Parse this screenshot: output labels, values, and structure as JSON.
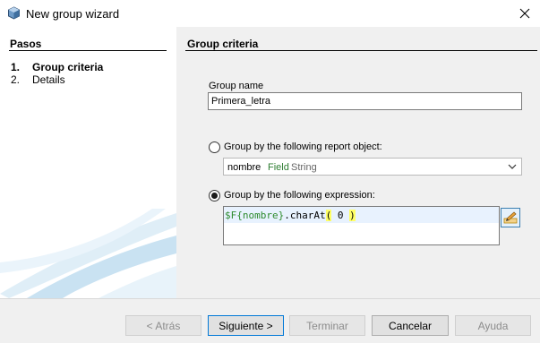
{
  "window": {
    "title": "New group wizard"
  },
  "steps": {
    "header": "Pasos",
    "items": [
      {
        "num": "1.",
        "label": "Group criteria"
      },
      {
        "num": "2.",
        "label": "Details"
      }
    ]
  },
  "panel": {
    "title": "Group criteria",
    "group_name_label": "Group name",
    "group_name_value": "Primera_letra",
    "option_report_object": "Group by the following report object:",
    "report_object": {
      "name": "nombre",
      "type": "Field",
      "class": "String"
    },
    "option_expression": "Group by the following expression:",
    "expression": {
      "part1": "$F{nombre}",
      "part2": ".charAt",
      "part3": "(",
      "part4": " 0 ",
      "part5": ")"
    }
  },
  "footer": {
    "back": "< Atrás",
    "next": "Siguiente >",
    "finish": "Terminar",
    "cancel": "Cancelar",
    "help": "Ayuda"
  },
  "colors": {
    "panel_bg": "#f0f0f0",
    "field_green": "#2e7d32",
    "highlight": "#ffff66",
    "selection": "#0078d7"
  },
  "icons": [
    "app-cube-icon",
    "close-icon",
    "chevron-down-icon",
    "edit-expression-icon"
  ]
}
